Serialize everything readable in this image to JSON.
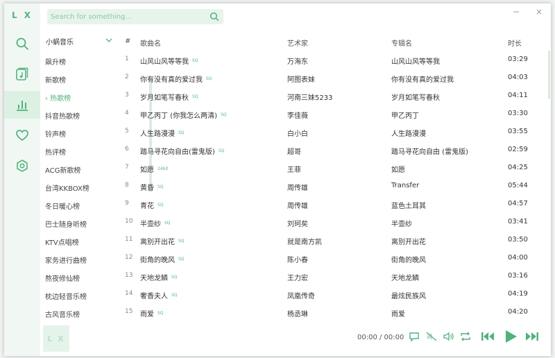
{
  "app": {
    "logo": "L X"
  },
  "search": {
    "placeholder": "Search for something..."
  },
  "window_controls": {
    "minimize": "−",
    "close": "×"
  },
  "nav": [
    "search-icon",
    "my-list-icon",
    "leaderboard-icon",
    "heart-icon",
    "settings-icon"
  ],
  "source": {
    "selected": "小蜗音乐"
  },
  "boards": [
    {
      "label": "飙升榜"
    },
    {
      "label": "新歌榜"
    },
    {
      "label": "› 热歌榜",
      "active": true
    },
    {
      "label": "抖音热歌榜"
    },
    {
      "label": "铃声榜"
    },
    {
      "label": "热评榜"
    },
    {
      "label": "ACG新歌榜"
    },
    {
      "label": "台湾KKBOX榜"
    },
    {
      "label": "冬日暖心榜"
    },
    {
      "label": "巴士随身听榜"
    },
    {
      "label": "KTV点唱榜"
    },
    {
      "label": "家务进行曲榜"
    },
    {
      "label": "熬夜修仙榜"
    },
    {
      "label": "枕边轻音乐榜"
    },
    {
      "label": "古风音乐榜"
    }
  ],
  "columns": {
    "num": "#",
    "title": "歌曲名",
    "artist": "艺术家",
    "album": "专辑名",
    "duration": "时长"
  },
  "songs": [
    {
      "num": "1",
      "title": "山风山风等等我",
      "tag": "SQ",
      "artist": "万海东",
      "album": "山风山风等等我",
      "duration": "03:29"
    },
    {
      "num": "2",
      "title": "你有没有真的爱过我",
      "tag": "SQ",
      "artist": "阿图表妹",
      "album": "你有没有真的爱过我",
      "duration": "04:03"
    },
    {
      "num": "3",
      "title": "岁月如笔写春秋",
      "tag": "SQ",
      "artist": "河南三妹5233",
      "album": "岁月如笔写春秋",
      "duration": "04:11"
    },
    {
      "num": "4",
      "title": "甲乙丙丁 (你我怎么两清)",
      "tag": "SQ",
      "artist": "李佳薇",
      "album": "甲乙丙丁",
      "duration": "03:30"
    },
    {
      "num": "5",
      "title": "人生路漫漫",
      "tag": "SQ",
      "artist": "白小白",
      "album": "人生路漫漫",
      "duration": "03:55"
    },
    {
      "num": "6",
      "title": "踏马寻花向自由(雷鬼版)",
      "tag": "SQ",
      "artist": "超哥",
      "album": "踏马寻花向自由 (雷鬼版)",
      "duration": "02:59"
    },
    {
      "num": "7",
      "title": "如愿",
      "tag": "24bit",
      "artist": "王菲",
      "album": "如愿",
      "duration": "04:25"
    },
    {
      "num": "8",
      "title": "黄昏",
      "tag": "SQ",
      "artist": "周传雄",
      "album": "Transfer",
      "duration": "05:44"
    },
    {
      "num": "9",
      "title": "青花",
      "tag": "SQ",
      "artist": "周传雄",
      "album": "蓝色土耳其",
      "duration": "04:57"
    },
    {
      "num": "10",
      "title": "半壶纱",
      "tag": "SQ",
      "artist": "刘珂矣",
      "album": "半壶纱",
      "duration": "03:41"
    },
    {
      "num": "11",
      "title": "离别开出花",
      "tag": "SQ",
      "artist": "就是南方凯",
      "album": "离别开出花",
      "duration": "03:50"
    },
    {
      "num": "12",
      "title": "街角的晚风",
      "tag": "SQ",
      "artist": "陈小春",
      "album": "街角的晚风",
      "duration": "04:00"
    },
    {
      "num": "13",
      "title": "天地龙鳞",
      "tag": "SQ",
      "artist": "王力宏",
      "album": "天地龙鳞",
      "duration": "03:16"
    },
    {
      "num": "14",
      "title": "奢香夫人",
      "tag": "SQ",
      "artist": "凤凰传奇",
      "album": "最炫民族风",
      "duration": "04:19"
    },
    {
      "num": "15",
      "title": "雨爱",
      "tag": "SQ",
      "artist": "杨丞琳",
      "album": "雨爱",
      "duration": "04:20"
    }
  ],
  "player": {
    "cover_text": "L X",
    "time": "00:00 / 00:00"
  },
  "colors": {
    "accent": "#4fb37c",
    "sidebar_bg": "#f1f8f4",
    "search_bg": "#e7f4ec"
  }
}
